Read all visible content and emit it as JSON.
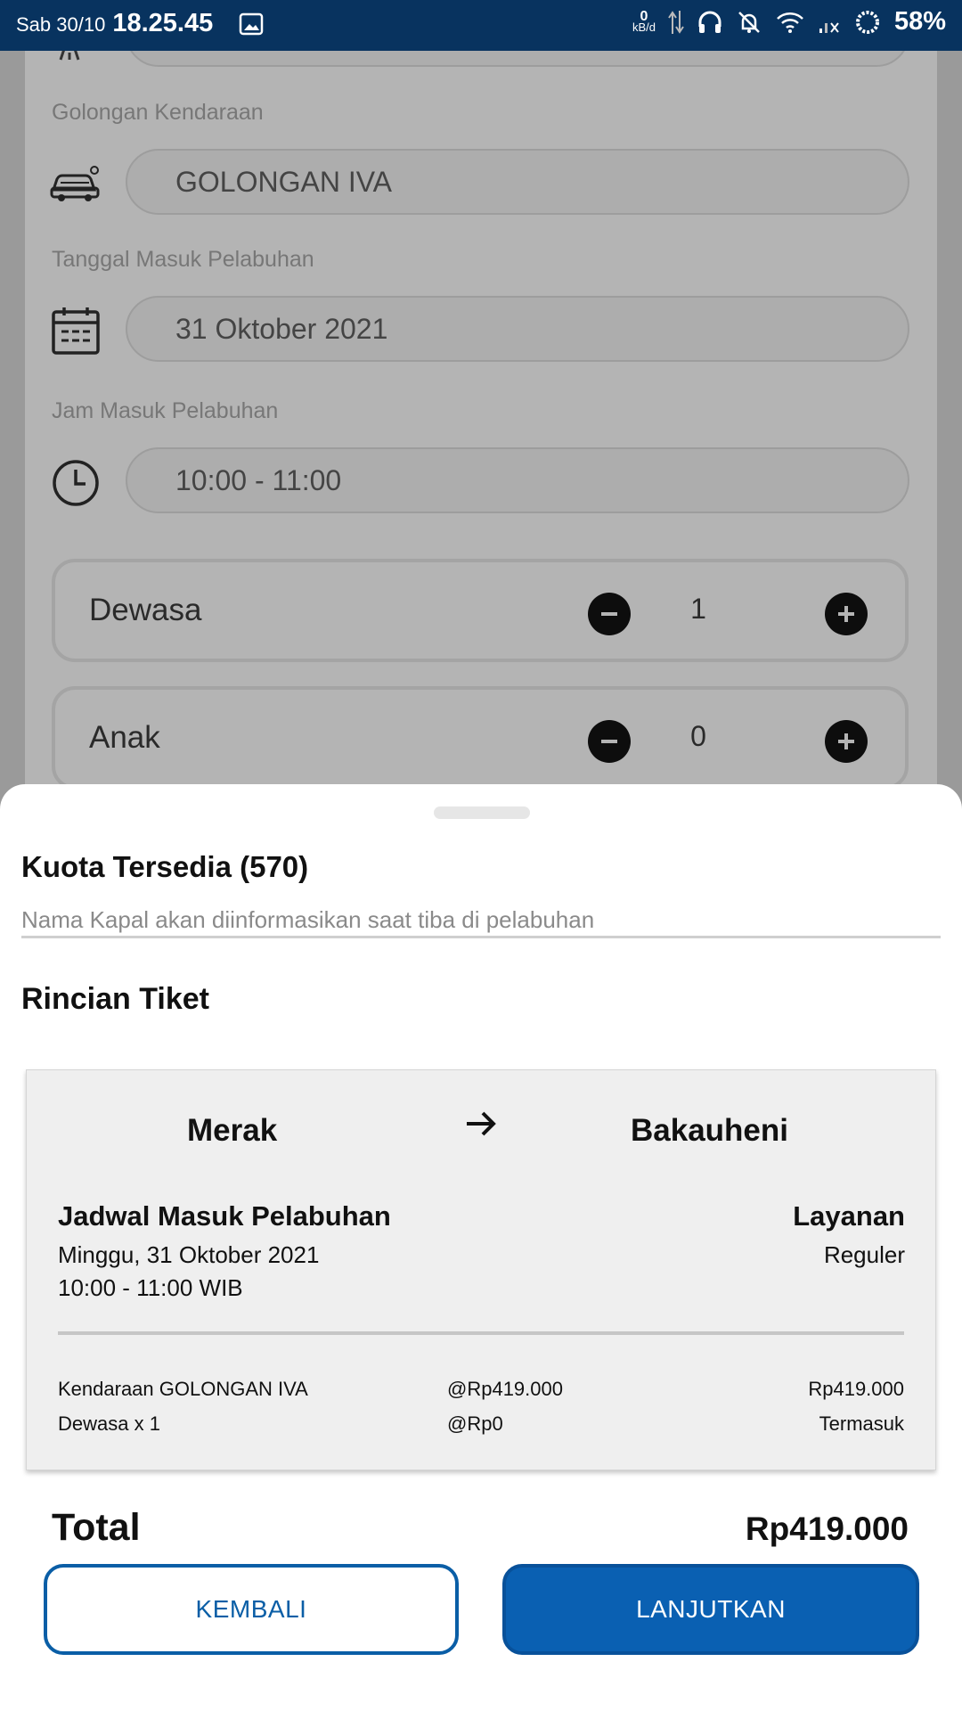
{
  "status_bar": {
    "date": "Sab 30/10",
    "time": "18.25.45",
    "net_speed": "0",
    "net_unit": "kB/d",
    "battery": "58%",
    "icons": [
      "image-icon",
      "data-arrows-icon",
      "headphones-icon",
      "bell-off-icon",
      "wifi-icon",
      "signal-icon",
      "battery-ring-icon"
    ]
  },
  "form": {
    "vehicle_class_label": "Golongan Kendaraan",
    "vehicle_class_value": "GOLONGAN IVA",
    "date_label": "Tanggal Masuk Pelabuhan",
    "date_value": "31 Oktober 2021",
    "time_label": "Jam Masuk Pelabuhan",
    "time_value": "10:00 - 11:00",
    "passengers": [
      {
        "label": "Dewasa",
        "count": "1"
      },
      {
        "label": "Anak",
        "count": "0"
      }
    ]
  },
  "sheet": {
    "quota_title": "Kuota Tersedia (570)",
    "ship_note": "Nama Kapal akan diinformasikan saat tiba di pelabuhan",
    "detail_title": "Rincian Tiket",
    "ticket": {
      "from": "Merak",
      "to": "Bakauheni",
      "schedule_title": "Jadwal Masuk Pelabuhan",
      "schedule_date": "Minggu, 31 Oktober 2021",
      "schedule_time": "10:00 - 11:00 WIB",
      "service_title": "Layanan",
      "service_value": "Reguler",
      "lines": [
        {
          "item": "Kendaraan GOLONGAN IVA",
          "unit_price": "@Rp419.000",
          "amount": "Rp419.000"
        },
        {
          "item": "Dewasa x 1",
          "unit_price": "@Rp0",
          "amount": "Termasuk"
        }
      ]
    },
    "total_label": "Total",
    "total_value": "Rp419.000",
    "back_button": "KEMBALI",
    "next_button": "LANJUTKAN"
  },
  "colors": {
    "status_bar": "#08335f",
    "primary": "#0a60b2",
    "primary_border": "#0a5ea6"
  }
}
